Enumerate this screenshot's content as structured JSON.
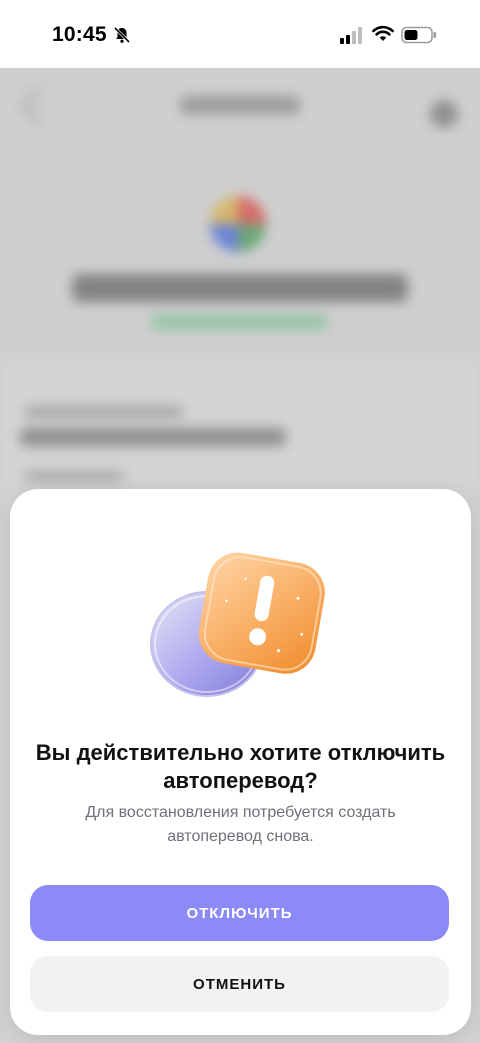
{
  "status_bar": {
    "time": "10:45",
    "icons": [
      "bell-off-icon",
      "cellular-signal-icon",
      "wifi-icon",
      "battery-icon"
    ]
  },
  "dialog": {
    "title": "Вы действительно хотите отключить автоперевод?",
    "subtitle": "Для восстановления потребуется создать автоперевод снова.",
    "confirm_label": "ОТКЛЮЧИТЬ",
    "cancel_label": "ОТМЕНИТЬ",
    "illustration": "warning-exclamation-icon"
  },
  "colors": {
    "accent": "#8b8af6",
    "secondary_button": "#f2f2f4",
    "warning_orange": "#f6a04a"
  }
}
